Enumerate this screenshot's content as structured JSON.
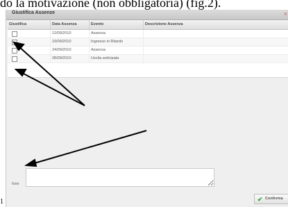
{
  "document": {
    "caption": "do la motivazione (non obbligatoria) (fig.2).",
    "footer_number": "1"
  },
  "dialog": {
    "title": "Giustifica Assenze",
    "close_glyph": "×",
    "columns": [
      "Giustifica",
      "Data Assenza",
      "Evento",
      "Descrizione Assenza"
    ],
    "rows": [
      {
        "checked": false,
        "data": "12/09/2010",
        "evento": "Assenza",
        "descrizione": ""
      },
      {
        "checked": false,
        "data": "19/09/2010",
        "evento": "Ingresso in Ritardo",
        "descrizione": ""
      },
      {
        "checked": false,
        "data": "24/09/2010",
        "evento": "Assenza",
        "descrizione": ""
      },
      {
        "checked": false,
        "data": "28/09/2010",
        "evento": "Uscita anticipata",
        "descrizione": ""
      }
    ],
    "note_label": "Note",
    "note_value": "",
    "confirm_label": "Conferma",
    "confirm_icon": "check-icon"
  },
  "colors": {
    "dialog_bg": "#efefef",
    "confirm_check": "#3aa43a",
    "arrow": "#000000"
  }
}
